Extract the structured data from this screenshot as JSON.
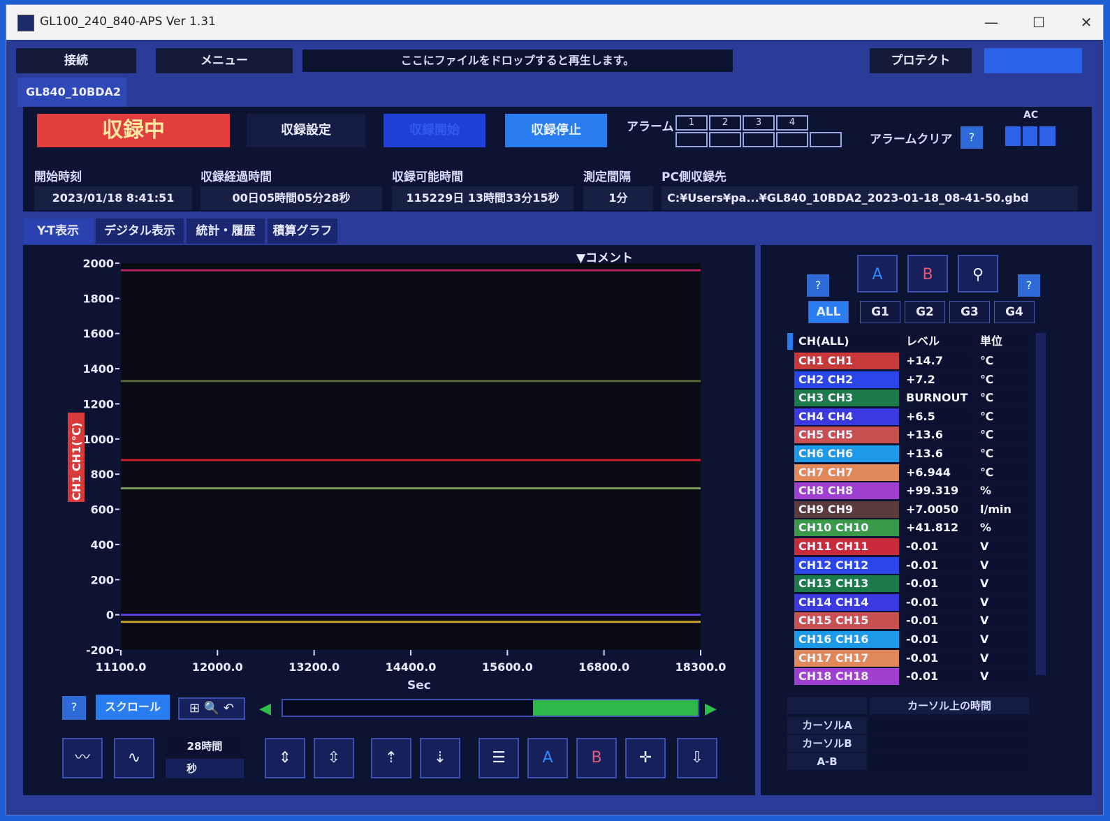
{
  "window": {
    "title": "GL100_240_840-APS Ver 1.31",
    "minimize": "—",
    "maximize": "☐",
    "close": "✕"
  },
  "top": {
    "connect": "接続",
    "menu": "メニュー",
    "drop_hint": "ここにファイルをドロップすると再生します。",
    "protect": "プロテクト"
  },
  "device_tab": "GL840_10BDA2",
  "status": {
    "recording": "収録中",
    "record_settings": "収録設定",
    "record_start": "収録開始",
    "record_stop": "収録停止",
    "alarm_label": "アラーム",
    "alarm_boxes": [
      "1",
      "2",
      "3",
      "4"
    ],
    "alarm_clear": "アラームクリア",
    "ac_label": "AC",
    "help": "?"
  },
  "info": {
    "start_time_label": "開始時刻",
    "start_time": "2023/01/18 8:41:51",
    "elapsed_label": "収録経過時間",
    "elapsed": "00日05時間05分28秒",
    "available_label": "収録可能時間",
    "available": "115229日 13時間33分15秒",
    "interval_label": "測定間隔",
    "interval": "1分",
    "pc_dest_label": "PC側収録先",
    "pc_dest": "C:¥Users¥pa...¥GL840_10BDA2_2023-01-18_08-41-50.gbd"
  },
  "view_tabs": [
    "Y-T表示",
    "デジタル表示",
    "統計・履歴",
    "積算グラフ"
  ],
  "graph": {
    "comment": "▼コメント",
    "ylabel": "CH1 CH1(℃)",
    "xlabel": "Sec",
    "scroll": "スクロール",
    "help": "?",
    "time_span": "28時間",
    "time_unit": "秒"
  },
  "chart_data": {
    "type": "line",
    "xlabel": "Sec",
    "ylabel": "CH1 CH1(℃)",
    "ylim": [
      -200,
      2000
    ],
    "xlim": [
      11100,
      16800
    ],
    "y_ticks": [
      2000,
      1800,
      1600,
      1400,
      1200,
      1000,
      800,
      600,
      400,
      200,
      0,
      -200
    ],
    "x_ticks": [
      "11100.0",
      "12000.0",
      "13200.0",
      "14400.0",
      "15600.0",
      "16800.0",
      "18300.0"
    ],
    "series": [
      {
        "color": "#b02060",
        "values": [
          1960,
          1960
        ]
      },
      {
        "color": "#5a6a3a",
        "values": [
          1330,
          1330
        ]
      },
      {
        "color": "#c81e2e",
        "values": [
          880,
          880
        ]
      },
      {
        "color": "#7a9a5a",
        "values": [
          720,
          720
        ]
      },
      {
        "color": "#5a40e0",
        "values": [
          0,
          0
        ]
      },
      {
        "color": "#c8a030",
        "values": [
          -40,
          -40
        ]
      }
    ]
  },
  "right": {
    "help": "?",
    "groups": [
      "ALL",
      "G1",
      "G2",
      "G3",
      "G4"
    ],
    "col_ch": "CH(ALL)",
    "col_level": "レベル",
    "col_unit": "単位",
    "channels": [
      {
        "name": "CH1  CH1",
        "level": "+14.7",
        "unit": "℃",
        "color": "#c83a3a"
      },
      {
        "name": "CH2  CH2",
        "level": "+7.2",
        "unit": "℃",
        "color": "#2a46e8"
      },
      {
        "name": "CH3  CH3",
        "level": "BURNOUT",
        "unit": "℃",
        "color": "#1d7a4a"
      },
      {
        "name": "CH4  CH4",
        "level": "+6.5",
        "unit": "℃",
        "color": "#3a3ae0"
      },
      {
        "name": "CH5  CH5",
        "level": "+13.6",
        "unit": "℃",
        "color": "#c85050"
      },
      {
        "name": "CH6  CH6",
        "level": "+13.6",
        "unit": "℃",
        "color": "#1c9ae8"
      },
      {
        "name": "CH7  CH7",
        "level": "+6.944",
        "unit": "℃",
        "color": "#e0885a"
      },
      {
        "name": "CH8  CH8",
        "level": "+99.319",
        "unit": "%",
        "color": "#a040d0"
      },
      {
        "name": "CH9  CH9",
        "level": "+7.0050",
        "unit": "l/min",
        "color": "#5a3a3a"
      },
      {
        "name": "CH10  CH10",
        "level": "+41.812",
        "unit": "%",
        "color": "#3a9a4a"
      },
      {
        "name": "CH11  CH11",
        "level": "-0.01",
        "unit": "V",
        "color": "#c82a3a"
      },
      {
        "name": "CH12  CH12",
        "level": "-0.01",
        "unit": "V",
        "color": "#2a46e8"
      },
      {
        "name": "CH13  CH13",
        "level": "-0.01",
        "unit": "V",
        "color": "#1d7a4a"
      },
      {
        "name": "CH14  CH14",
        "level": "-0.01",
        "unit": "V",
        "color": "#3a3ae0"
      },
      {
        "name": "CH15  CH15",
        "level": "-0.01",
        "unit": "V",
        "color": "#c85050"
      },
      {
        "name": "CH16  CH16",
        "level": "-0.01",
        "unit": "V",
        "color": "#1c9ae8"
      },
      {
        "name": "CH17  CH17",
        "level": "-0.01",
        "unit": "V",
        "color": "#e0885a"
      },
      {
        "name": "CH18  CH18",
        "level": "-0.01",
        "unit": "V",
        "color": "#a040d0"
      }
    ],
    "cursor_header": "カーソル上の時間",
    "cursor_a": "カーソルA",
    "cursor_b": "カーソルB",
    "cursor_ab": "A-B"
  }
}
